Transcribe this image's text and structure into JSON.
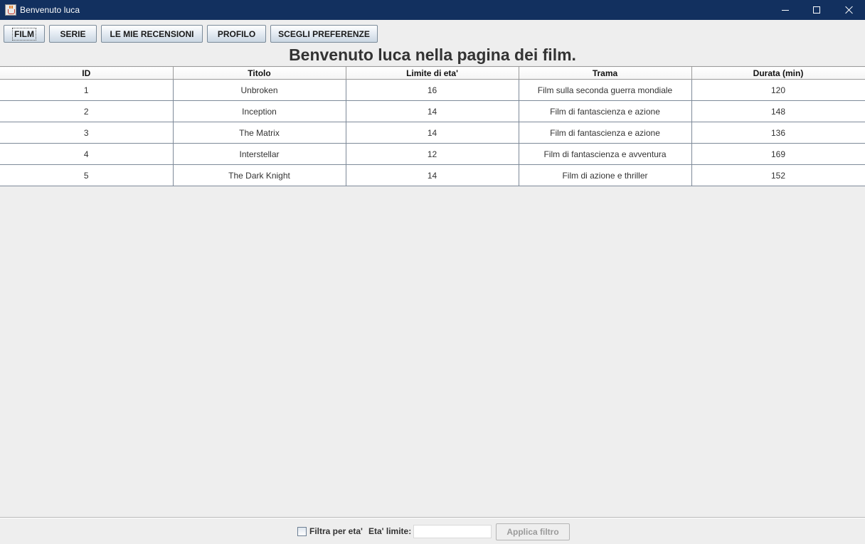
{
  "window": {
    "title": "Benvenuto luca"
  },
  "toolbar": {
    "buttons": [
      {
        "label": "FILM"
      },
      {
        "label": "SERIE"
      },
      {
        "label": "LE MIE RECENSIONI"
      },
      {
        "label": "PROFILO"
      },
      {
        "label": "SCEGLI PREFERENZE"
      }
    ]
  },
  "heading": "Benvenuto luca nella pagina dei film.",
  "table": {
    "columns": [
      "ID",
      "Titolo",
      "Limite di eta'",
      "Trama",
      "Durata (min)"
    ],
    "rows": [
      [
        "1",
        "Unbroken",
        "16",
        "Film sulla seconda guerra mondiale",
        "120"
      ],
      [
        "2",
        "Inception",
        "14",
        "Film di fantascienza e azione",
        "148"
      ],
      [
        "3",
        "The Matrix",
        "14",
        "Film di fantascienza e azione",
        "136"
      ],
      [
        "4",
        "Interstellar",
        "12",
        "Film di fantascienza e avventura",
        "169"
      ],
      [
        "5",
        "The Dark Knight",
        "14",
        "Film di azione e thriller",
        "152"
      ]
    ]
  },
  "filter": {
    "checkbox_label": "Filtra per eta'",
    "age_label": "Eta' limite:",
    "age_value": "",
    "apply_label": "Applica filtro"
  }
}
